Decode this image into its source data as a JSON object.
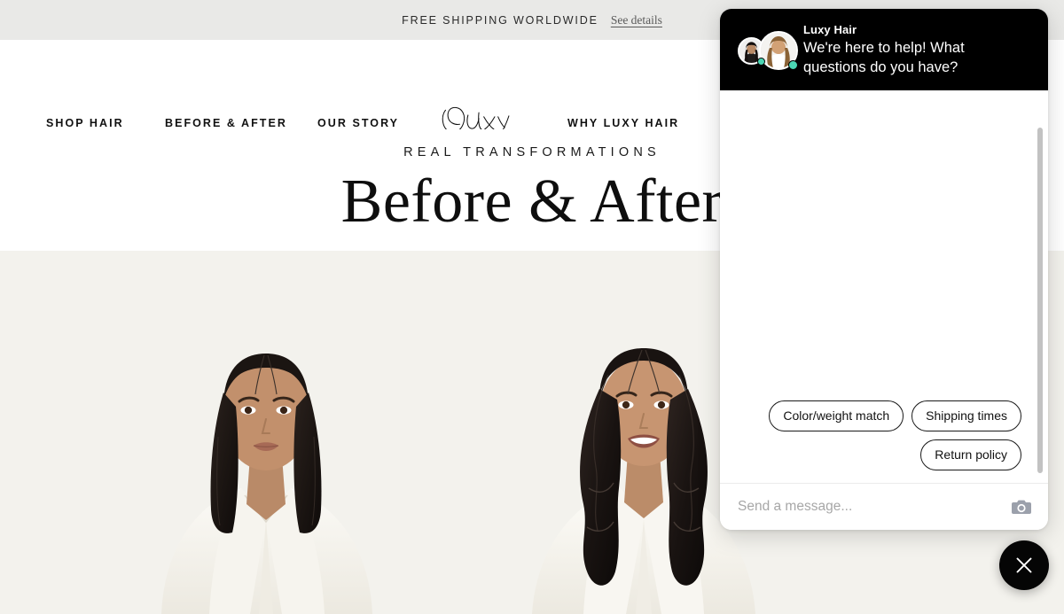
{
  "announcement": {
    "text": "FREE SHIPPING WORLDWIDE",
    "link_label": "See details"
  },
  "nav": {
    "logo_text": "Luxy",
    "items": [
      {
        "label": "SHOP HAIR"
      },
      {
        "label": "BEFORE & AFTER"
      },
      {
        "label": "OUR STORY"
      },
      {
        "label": "WHY LUXY HAIR"
      }
    ]
  },
  "hero": {
    "eyebrow": "REAL TRANSFORMATIONS",
    "title": "Before & After"
  },
  "gallery": {
    "before_alt": "Model with straight shoulder-length dark hair in white blazer",
    "after_alt": "Model with long wavy dark hair extensions in white blazer"
  },
  "chat": {
    "brand": "Luxy Hair",
    "greeting": "We're here to help! What questions do you have?",
    "quick_replies": [
      {
        "label": "Color/weight match"
      },
      {
        "label": "Shipping times"
      },
      {
        "label": "Return policy"
      }
    ],
    "input_placeholder": "Send a message...",
    "input_value": "",
    "camera_icon": "camera-icon",
    "close_icon": "close-icon",
    "status_color": "#4bd6b4"
  },
  "colors": {
    "announce_bg": "#e9e9e7",
    "page_bg": "#ffffff",
    "gallery_bg": "#f3f2ed",
    "chat_header_bg": "#000000",
    "fab_bg": "#050505"
  }
}
